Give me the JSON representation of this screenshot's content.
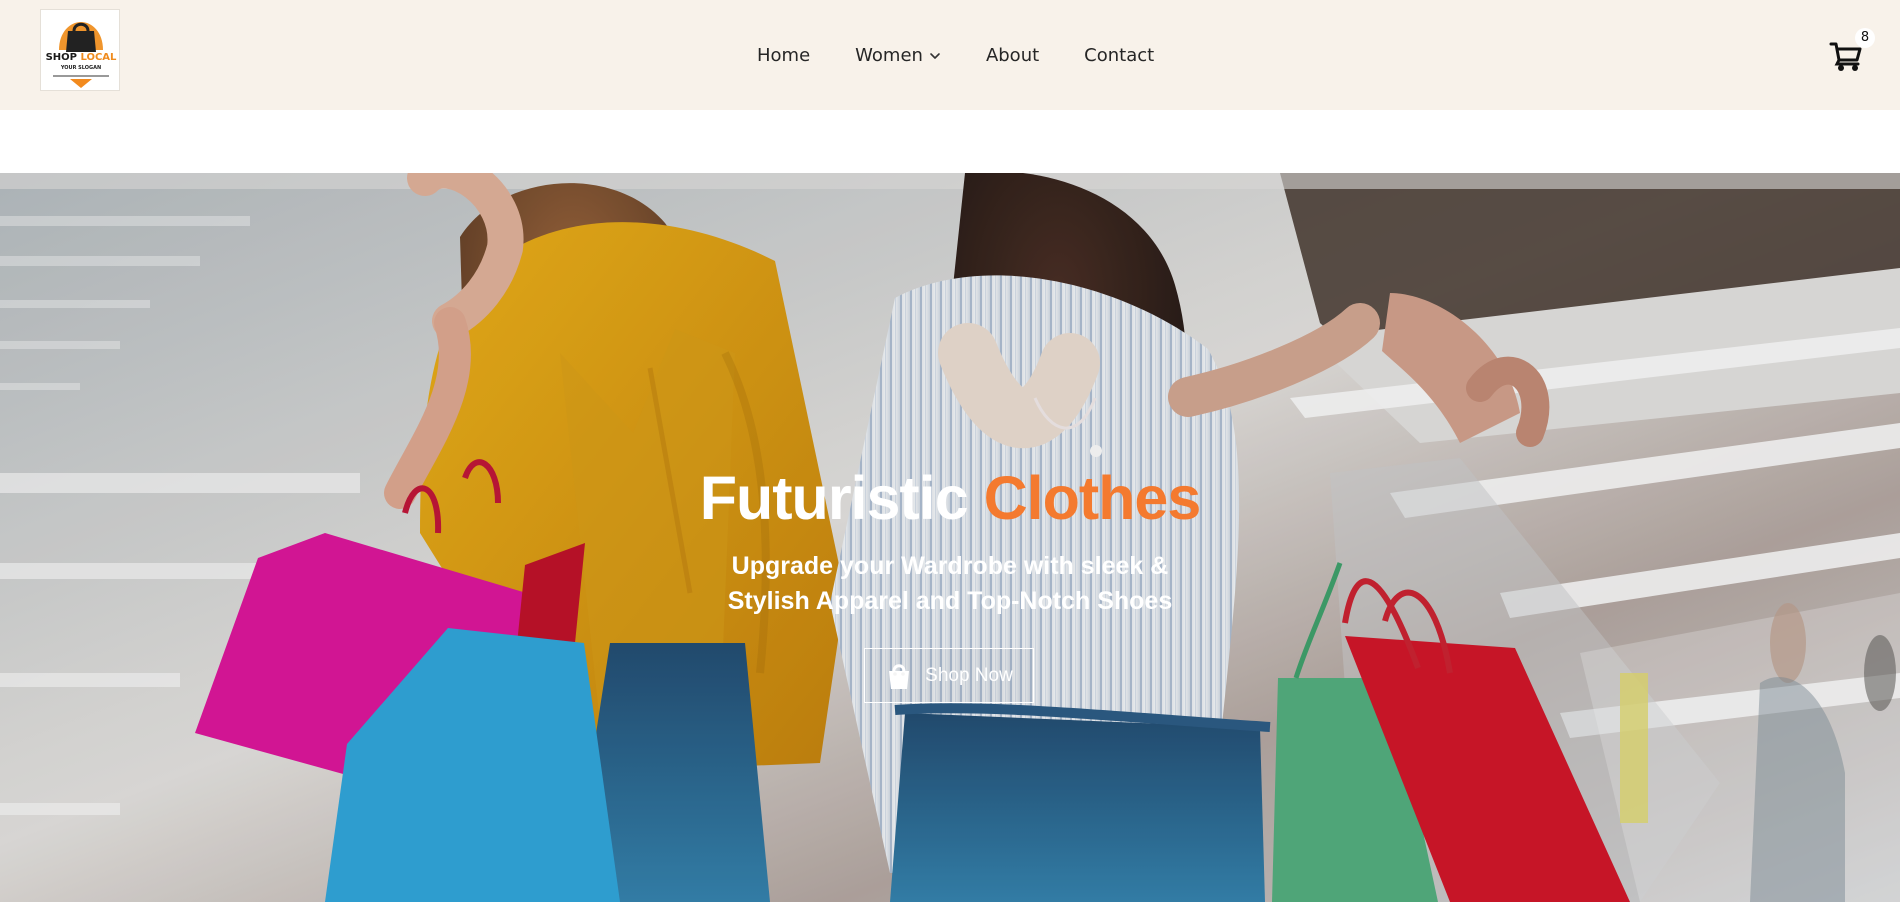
{
  "brand": {
    "logo_primary": "SHOP",
    "logo_secondary": "LOCAL",
    "logo_slogan": "YOUR SLOGAN",
    "accent_color": "#ef8b1e"
  },
  "header": {
    "background_color": "#f8f2ea",
    "nav": {
      "home": "Home",
      "women": "Women",
      "about": "About",
      "contact": "Contact"
    },
    "cart": {
      "icon": "cart-icon",
      "count": "8"
    }
  },
  "hero": {
    "title_main": "Futuristic",
    "title_accent": "Clothes",
    "title_accent_color": "#f47a2f",
    "subtitle": "Upgrade your Wardrobe with sleek & Stylish Apparel and Top-Notch Shoes",
    "button_label": "Shop Now",
    "button_icon": "shopping-bag-icon"
  }
}
